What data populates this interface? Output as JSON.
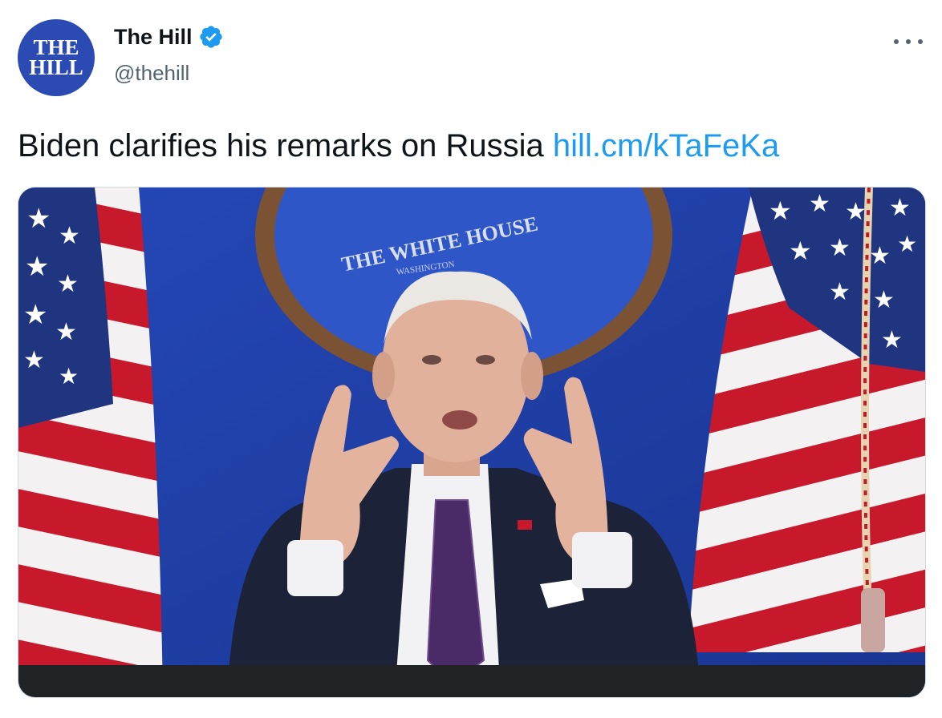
{
  "author": {
    "avatar_line1": "THE",
    "avatar_line2": "HILL",
    "display_name": "The Hill",
    "handle": "@thehill",
    "verified": true
  },
  "tweet": {
    "text": "Biden clarifies his remarks on Russia ",
    "link": "hill.cm/kTaFeKa"
  },
  "media": {
    "seal_text": "THE WHITE HOUSE",
    "seal_subtext": "WASHINGTON"
  },
  "icons": {
    "verified": "verified-badge-icon",
    "more": "more-options-icon"
  },
  "colors": {
    "link": "#1d9bf0",
    "verified": "#1d9bf0",
    "avatar_bg": "#2c4ab4"
  }
}
